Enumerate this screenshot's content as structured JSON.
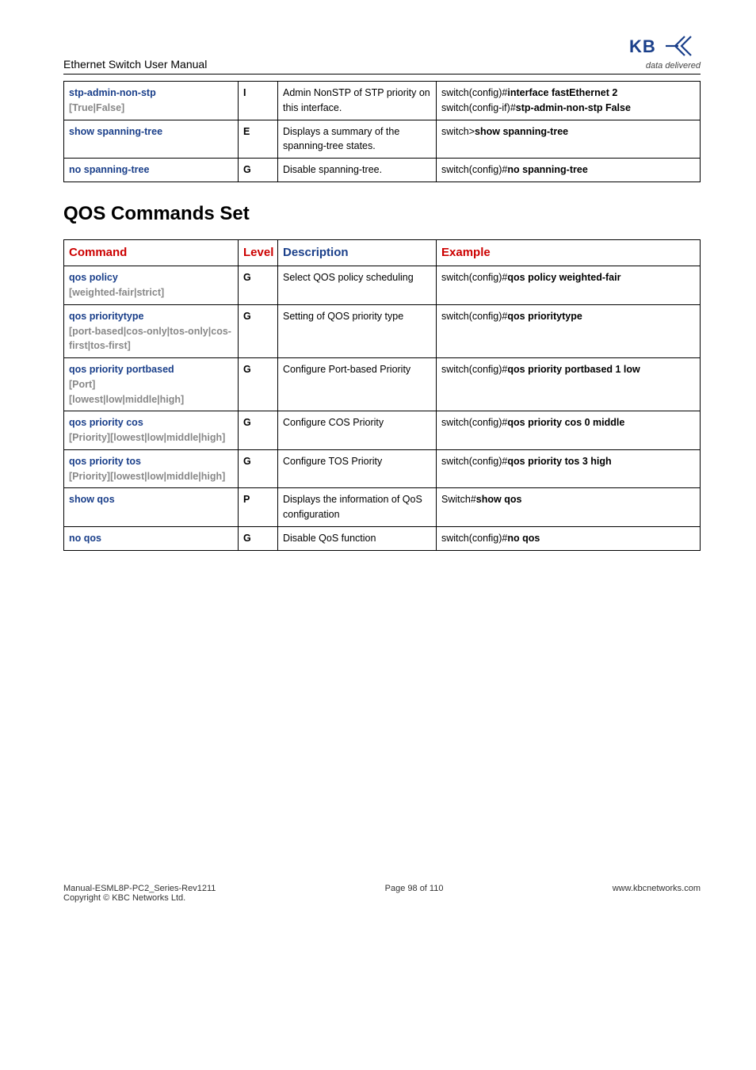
{
  "header": {
    "title": "Ethernet Switch User Manual",
    "tagline": "data delivered"
  },
  "table_top": {
    "rows": [
      {
        "cmd_blue": "stp-admin-non-stp",
        "cmd_gray": "[True|False]",
        "level": "I",
        "desc": "Admin NonSTP of STP priority on this interface.",
        "ex_lines": [
          {
            "pre": "switch(config)#",
            "bold": "interface fastEthernet 2"
          },
          {
            "pre": "switch(config-if)#",
            "bold": "stp-admin-non-stp False"
          }
        ]
      },
      {
        "cmd_blue": "show spanning-tree",
        "cmd_gray": "",
        "level": "E",
        "desc": "Displays a summary of the spanning-tree states.",
        "ex_lines": [
          {
            "pre": "switch>",
            "bold": "show spanning-tree"
          }
        ]
      },
      {
        "cmd_blue": "no spanning-tree",
        "cmd_gray": "",
        "level": "G",
        "desc": "Disable spanning-tree.",
        "ex_lines": [
          {
            "pre": "switch(config)#",
            "bold": "no spanning-tree"
          }
        ]
      }
    ]
  },
  "section_title": "QOS Commands Set",
  "table_qos": {
    "headers": {
      "cmd": "Command",
      "level": "Level",
      "desc": "Description",
      "ex": "Example"
    },
    "rows": [
      {
        "cmd_blue": "qos policy",
        "cmd_gray": "[weighted-fair|strict]",
        "level": "G",
        "desc": "Select QOS policy scheduling",
        "ex_lines": [
          {
            "pre": "switch(config)#",
            "bold": "qos policy weighted-fair"
          }
        ]
      },
      {
        "cmd_blue": "qos prioritytype",
        "cmd_gray": "[port-based|cos-only|tos-only|cos-first|tos-first]",
        "level": "G",
        "desc": "Setting of QOS priority type",
        "ex_lines": [
          {
            "pre": "switch(config)#",
            "bold": "qos prioritytype"
          }
        ]
      },
      {
        "cmd_blue": "qos priority portbased",
        "cmd_gray": "[Port]\n[lowest|low|middle|high]",
        "level": "G",
        "desc": "Configure Port-based Priority",
        "ex_lines": [
          {
            "pre": "switch(config)#",
            "bold": "qos priority portbased 1 low"
          }
        ]
      },
      {
        "cmd_blue": "qos priority cos",
        "cmd_gray": "[Priority][lowest|low|middle|high]",
        "level": "G",
        "desc": "Configure COS Priority",
        "ex_lines": [
          {
            "pre": "switch(config)#",
            "bold": "qos priority cos 0 middle"
          }
        ]
      },
      {
        "cmd_blue": "qos priority tos",
        "cmd_gray": "[Priority][lowest|low|middle|high]",
        "level": "G",
        "desc": "Configure TOS Priority",
        "ex_lines": [
          {
            "pre": "switch(config)#",
            "bold": "qos priority tos 3 high"
          }
        ]
      },
      {
        "cmd_blue": "show qos",
        "cmd_gray": "",
        "level": "P",
        "desc": "Displays the information of QoS configuration",
        "ex_lines": [
          {
            "pre": "Switch#",
            "bold": "show qos"
          }
        ]
      },
      {
        "cmd_blue": "no qos",
        "cmd_gray": "",
        "level": "G",
        "desc": "Disable QoS function",
        "ex_lines": [
          {
            "pre": "switch(config)#",
            "bold": "no qos"
          }
        ]
      }
    ]
  },
  "footer": {
    "left1": "Manual-ESML8P-PC2_Series-Rev1211",
    "left2": "Copyright © KBC Networks Ltd.",
    "center": "Page 98 of 110",
    "right": "www.kbcnetworks.com"
  }
}
